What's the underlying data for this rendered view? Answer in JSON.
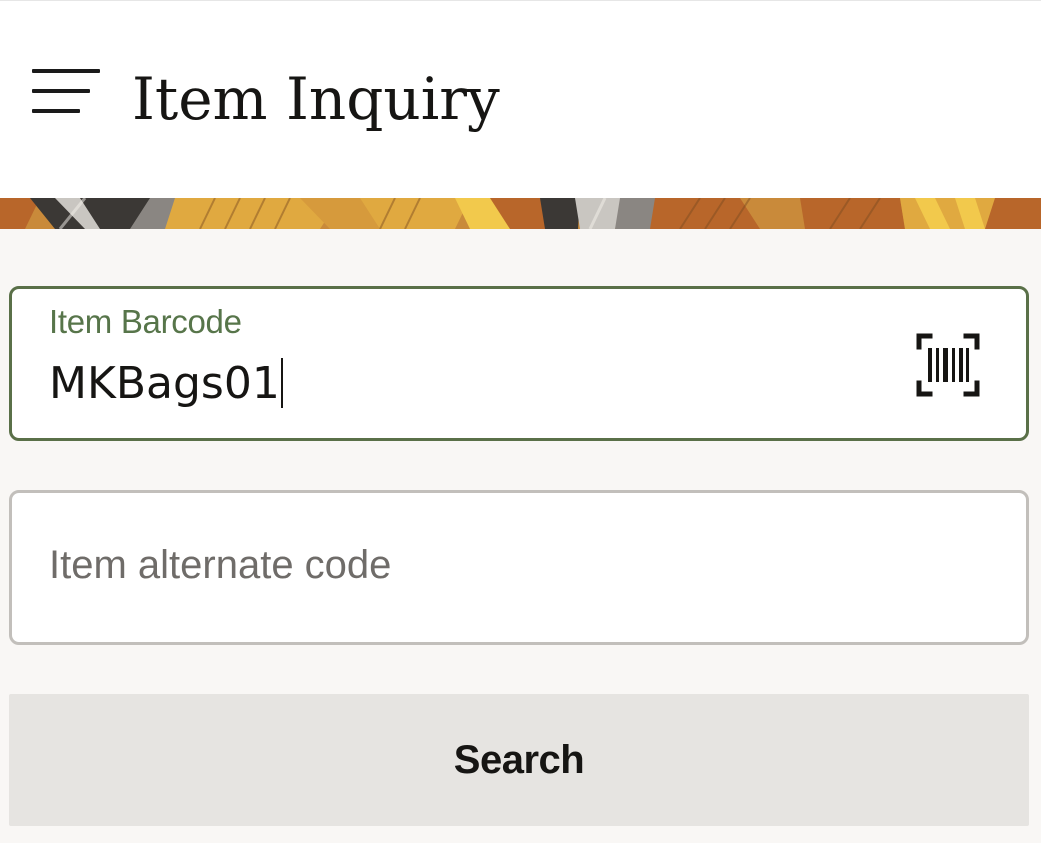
{
  "header": {
    "title": "Item Inquiry",
    "menu_icon": "hamburger-menu-icon"
  },
  "banner": {
    "colors": [
      "#3b3835",
      "#c9c6c1",
      "#e0a940",
      "#b8662a",
      "#f2c94c",
      "#8a8682"
    ]
  },
  "form": {
    "barcode": {
      "label": "Item Barcode",
      "value": "MKBags01",
      "scan_icon": "barcode-scan-icon"
    },
    "alternate_code": {
      "placeholder": "Item alternate code",
      "value": ""
    },
    "search_label": "Search"
  },
  "colors": {
    "accent": "#5a7048",
    "label": "#57754a",
    "field_border": "#c2bfbb",
    "button_bg": "#e6e4e1",
    "page_bg": "#f9f7f5"
  }
}
